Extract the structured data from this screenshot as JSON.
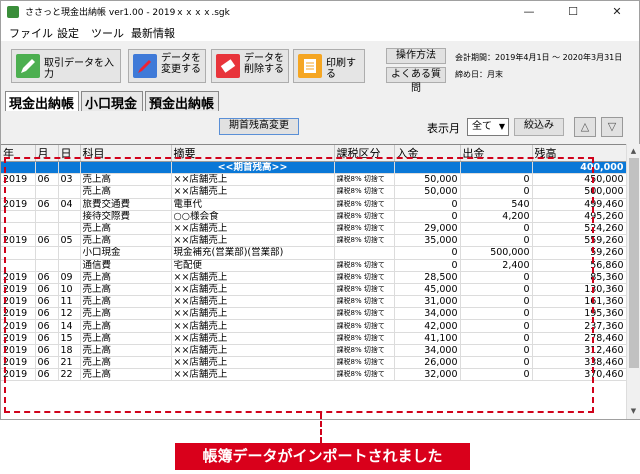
{
  "window": {
    "title": "ささっと現金出納帳 ver1.00 - 2019ｘｘｘｘ.sgk",
    "minimize": "—",
    "maximize": "☐",
    "close": "✕"
  },
  "menu": [
    "ファイル",
    "設定",
    "ツール",
    "最新情報"
  ],
  "toolbar": {
    "input": "取引データを入力",
    "edit": "データを\n変更する",
    "delete": "データを\n削除する",
    "print": "印刷する",
    "howto": "操作方法",
    "faq": "よくある質問",
    "period_label": "会計期間：2019年4月1日 〜 2020年3月31日",
    "closing_label": "締め日：月末"
  },
  "tabs": [
    "現金出納帳",
    "小口現金",
    "預金出納帳"
  ],
  "controls": {
    "change_opening_balance": "期首残高変更",
    "display_month_label": "表示月",
    "month_value": "全て",
    "filter": "絞込み",
    "up": "△",
    "down": "▽"
  },
  "icons": {
    "input": "pencil-icon",
    "edit": "pen-icon",
    "delete": "eraser-icon",
    "print": "printer-icon"
  },
  "colors": {
    "selected_row": "#0a78d7",
    "highlight": "#d9001b"
  },
  "table": {
    "columns": [
      "年",
      "月",
      "日",
      "科目",
      "摘要",
      "課税区分",
      "入金",
      "出金",
      "残高"
    ],
    "rows": [
      [
        "",
        "",
        "",
        "",
        "<<期首残高>>",
        "",
        "",
        "",
        "400,000"
      ],
      [
        "2019",
        "06",
        "03",
        "売上高",
        "××店舗売上",
        "課税8% 切捨て",
        "50,000",
        "0",
        "450,000"
      ],
      [
        "",
        "",
        "",
        "売上高",
        "××店舗売上",
        "課税8% 切捨て",
        "50,000",
        "0",
        "500,000"
      ],
      [
        "2019",
        "06",
        "04",
        "旅費交通費",
        "電車代",
        "課税8% 切捨て",
        "0",
        "540",
        "499,460"
      ],
      [
        "",
        "",
        "",
        "接待交際費",
        "○○様会食",
        "課税8% 切捨て",
        "0",
        "4,200",
        "495,260"
      ],
      [
        "",
        "",
        "",
        "売上高",
        "××店舗売上",
        "課税8% 切捨て",
        "29,000",
        "0",
        "524,260"
      ],
      [
        "2019",
        "06",
        "05",
        "売上高",
        "××店舗売上",
        "課税8% 切捨て",
        "35,000",
        "0",
        "559,260"
      ],
      [
        "",
        "",
        "",
        "小口現金",
        "現金補充(営業部)(営業部)",
        "",
        "0",
        "500,000",
        "59,260"
      ],
      [
        "",
        "",
        "",
        "通信費",
        "宅配便",
        "課税8% 切捨て",
        "0",
        "2,400",
        "56,860"
      ],
      [
        "2019",
        "06",
        "09",
        "売上高",
        "××店舗売上",
        "課税8% 切捨て",
        "28,500",
        "0",
        "85,360"
      ],
      [
        "2019",
        "06",
        "10",
        "売上高",
        "××店舗売上",
        "課税8% 切捨て",
        "45,000",
        "0",
        "130,360"
      ],
      [
        "2019",
        "06",
        "11",
        "売上高",
        "××店舗売上",
        "課税8% 切捨て",
        "31,000",
        "0",
        "161,360"
      ],
      [
        "2019",
        "06",
        "12",
        "売上高",
        "××店舗売上",
        "課税8% 切捨て",
        "34,000",
        "0",
        "195,360"
      ],
      [
        "2019",
        "06",
        "14",
        "売上高",
        "××店舗売上",
        "課税8% 切捨て",
        "42,000",
        "0",
        "237,360"
      ],
      [
        "2019",
        "06",
        "15",
        "売上高",
        "××店舗売上",
        "課税8% 切捨て",
        "41,100",
        "0",
        "278,460"
      ],
      [
        "2019",
        "06",
        "18",
        "売上高",
        "××店舗売上",
        "課税8% 切捨て",
        "34,000",
        "0",
        "312,460"
      ],
      [
        "2019",
        "06",
        "21",
        "売上高",
        "××店舗売上",
        "課税8% 切捨て",
        "26,000",
        "0",
        "338,460"
      ],
      [
        "2019",
        "06",
        "22",
        "売上高",
        "××店舗売上",
        "課税8% 切捨て",
        "32,000",
        "0",
        "370,460"
      ]
    ]
  },
  "banner": "帳簿データがインポートされました"
}
